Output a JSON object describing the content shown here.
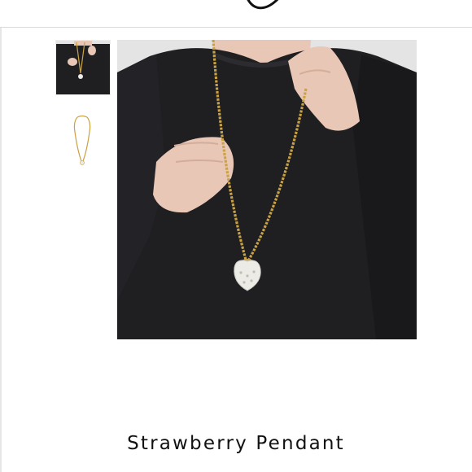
{
  "product": {
    "title": "Strawberry Pendant"
  },
  "gallery": {
    "thumbnails": [
      {
        "icon": "model-wearing-pendant-thumbnail"
      },
      {
        "icon": "pendant-on-chain-thumbnail"
      }
    ],
    "main_image_icon": "model-wearing-strawberry-pendant-photo"
  },
  "colors": {
    "shirt": "#1f1f22",
    "chain": "#c9a243",
    "pendant": "#ecebe6",
    "skin": "#e8c7b7",
    "background": "#e4e4e4"
  }
}
